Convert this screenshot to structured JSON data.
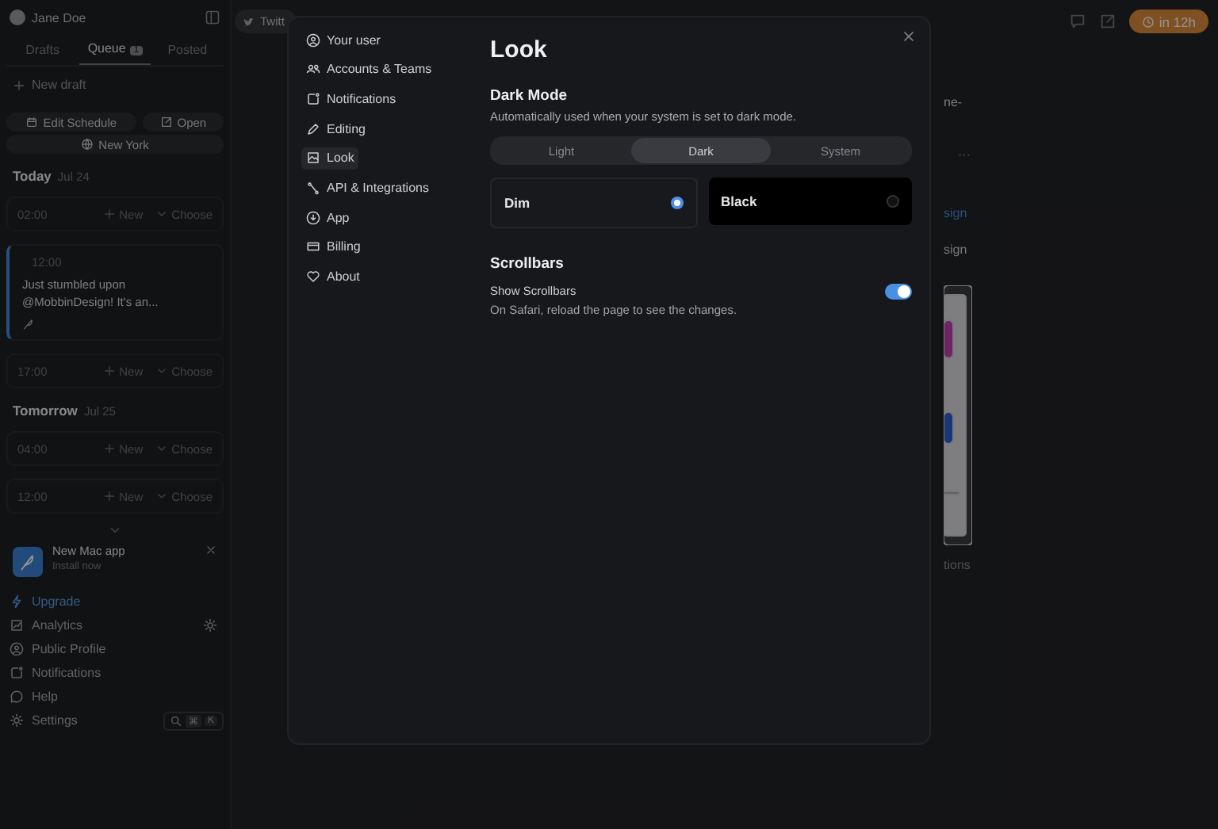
{
  "sidebar": {
    "user": "Jane Doe",
    "tabs": [
      {
        "label": "Drafts",
        "selected": false
      },
      {
        "label": "Queue",
        "badge": "1",
        "selected": true
      },
      {
        "label": "Posted",
        "selected": false
      }
    ],
    "new_draft": "New draft",
    "actions": [
      "Edit Schedule",
      "Open"
    ],
    "timezone": "New York",
    "days": [
      {
        "label": "Today",
        "date": "Jul 24",
        "slots": [
          {
            "kind": "empty",
            "time": "02:00",
            "new": "New",
            "choose": "Choose"
          },
          {
            "kind": "post",
            "time": "12:00",
            "text": "Just stumbled upon @MobbinDesign! It's an..."
          },
          {
            "kind": "empty",
            "time": "17:00",
            "new": "New",
            "choose": "Choose"
          }
        ]
      },
      {
        "label": "Tomorrow",
        "date": "Jul 25",
        "slots": [
          {
            "kind": "empty",
            "time": "04:00",
            "new": "New",
            "choose": "Choose"
          },
          {
            "kind": "empty",
            "time": "12:00",
            "new": "New",
            "choose": "Choose"
          }
        ]
      }
    ],
    "promo": {
      "title": "New Mac app",
      "subtitle": "Install now"
    },
    "nav": [
      {
        "label": "Upgrade",
        "highlighted": true
      },
      {
        "label": "Analytics",
        "highlighted": false
      },
      {
        "label": "Public Profile",
        "highlighted": false
      },
      {
        "label": "Notifications",
        "highlighted": false
      },
      {
        "label": "Help",
        "highlighted": false
      },
      {
        "label": "Settings",
        "highlighted": false
      }
    ],
    "shortcut": [
      "⌘",
      "K"
    ]
  },
  "main": {
    "account_chip": "Twitt",
    "schedule_button": "in 12h",
    "fragments": [
      {
        "kind": "text",
        "text": "ne-"
      },
      {
        "kind": "more",
        "text": "···"
      },
      {
        "kind": "link",
        "text": "sign"
      },
      {
        "kind": "text",
        "text": "sign"
      },
      {
        "kind": "picture"
      },
      {
        "kind": "text",
        "text": "tions"
      }
    ]
  },
  "settings": {
    "nav": [
      {
        "label": "Your user",
        "selected": false
      },
      {
        "label": "Accounts & Teams",
        "selected": false
      },
      {
        "label": "Notifications",
        "selected": false
      },
      {
        "label": "Editing",
        "selected": false
      },
      {
        "label": "Look",
        "selected": true
      },
      {
        "label": "API & Integrations",
        "selected": false
      },
      {
        "label": "App",
        "selected": false
      },
      {
        "label": "Billing",
        "selected": false
      },
      {
        "label": "About",
        "selected": false
      }
    ],
    "title": "Look",
    "dark_mode": {
      "heading": "Dark Mode",
      "description": "Automatically used when your system is set to dark mode.",
      "modes": [
        {
          "label": "Light",
          "selected": false
        },
        {
          "label": "Dark",
          "selected": true
        },
        {
          "label": "System",
          "selected": false
        }
      ],
      "themes": [
        {
          "label": "Dim",
          "selected": true
        },
        {
          "label": "Black",
          "selected": false
        }
      ]
    },
    "scrollbars": {
      "heading": "Scrollbars",
      "label": "Show Scrollbars",
      "description": "On Safari, reload the page to see the changes.",
      "on": true
    }
  }
}
